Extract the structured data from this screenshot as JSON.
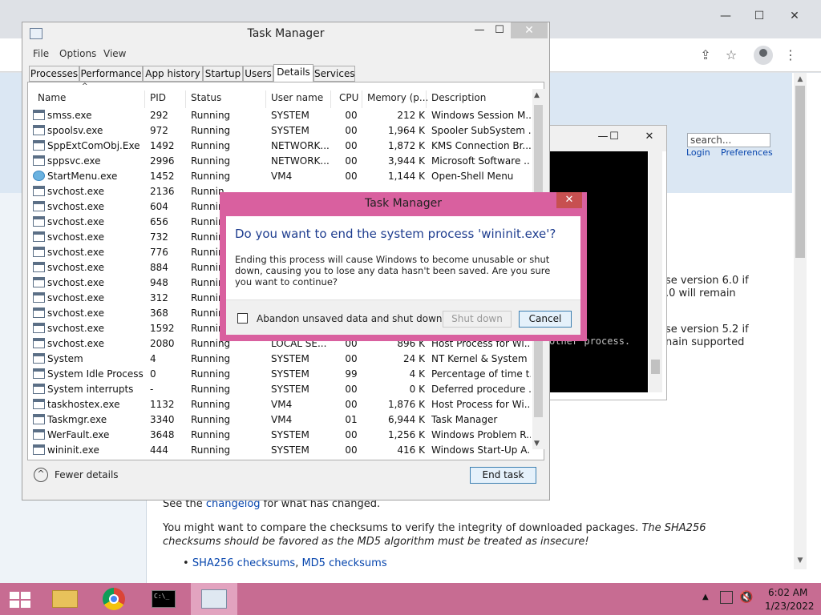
{
  "colors": {
    "dialog_frame": "#d9609f",
    "taskbar": "#c76c92",
    "question_text": "#1e3d8f",
    "link": "#0645ad"
  },
  "browser": {
    "window_controls": [
      "—",
      "☐",
      "✕"
    ],
    "toolbar_icons": [
      "share-icon",
      "star-icon",
      "profile-icon",
      "menu-kebab-icon"
    ],
    "search": {
      "placeholder": "search..."
    },
    "links": {
      "login": "Login",
      "preferences": "Preferences"
    },
    "text_fragments": {
      "frag1": "se version 6.0 if",
      "frag2": ".0 will remain",
      "frag3": "se version 5.2 if",
      "frag4": "nain supported"
    },
    "changelog_pre": "See the",
    "changelog_link": "changelog",
    "changelog_post": "for what has changed.",
    "checksum_text": "You might want to compare the checksums to verify the integrity of downloaded packages.",
    "checksum_italic": "The SHA256 checksums should be favored as the MD5 algorithm must be treated as insecure!",
    "sha_link": "SHA256 checksums",
    "md5_link": "MD5 checksums"
  },
  "console": {
    "buttons": [
      "—",
      "☐",
      "✕"
    ],
    "text": "other process."
  },
  "task_manager": {
    "title": "Task Manager",
    "window_controls": [
      "—",
      "☐",
      "✕"
    ],
    "menu": [
      "File",
      "Options",
      "View"
    ],
    "tabs": [
      "Processes",
      "Performance",
      "App history",
      "Startup",
      "Users",
      "Details",
      "Services"
    ],
    "active_tab": "Details",
    "columns": [
      "Name",
      "PID",
      "Status",
      "User name",
      "CPU",
      "Memory (p...",
      "Description"
    ],
    "rows": [
      [
        "smss.exe",
        "292",
        "Running",
        "SYSTEM",
        "00",
        "212 K",
        "Windows Session M..."
      ],
      [
        "spoolsv.exe",
        "972",
        "Running",
        "SYSTEM",
        "00",
        "1,964 K",
        "Spooler SubSystem ..."
      ],
      [
        "SppExtComObj.Exe",
        "1492",
        "Running",
        "NETWORK...",
        "00",
        "1,872 K",
        "KMS Connection Br..."
      ],
      [
        "sppsvc.exe",
        "2996",
        "Running",
        "NETWORK...",
        "00",
        "3,944 K",
        "Microsoft Software ..."
      ],
      [
        "StartMenu.exe",
        "1452",
        "Running",
        "VM4",
        "00",
        "1,144 K",
        "Open-Shell Menu"
      ],
      [
        "svchost.exe",
        "2136",
        "Runnin",
        "",
        "",
        "",
        ""
      ],
      [
        "svchost.exe",
        "604",
        "Runnin",
        "",
        "",
        "",
        ""
      ],
      [
        "svchost.exe",
        "656",
        "Runnin",
        "",
        "",
        "",
        ""
      ],
      [
        "svchost.exe",
        "732",
        "Runnin",
        "",
        "",
        "",
        ""
      ],
      [
        "svchost.exe",
        "776",
        "Runnin",
        "",
        "",
        "",
        ""
      ],
      [
        "svchost.exe",
        "884",
        "Runnin",
        "",
        "",
        "",
        ""
      ],
      [
        "svchost.exe",
        "948",
        "Runnin",
        "",
        "",
        "",
        ""
      ],
      [
        "svchost.exe",
        "312",
        "Runnin",
        "",
        "",
        "",
        ""
      ],
      [
        "svchost.exe",
        "368",
        "Runnin",
        "",
        "",
        "",
        ""
      ],
      [
        "svchost.exe",
        "1592",
        "Runnin",
        "",
        "",
        "",
        ""
      ],
      [
        "svchost.exe",
        "2080",
        "Running",
        "LOCAL SE...",
        "00",
        "896 K",
        "Host Process for Wi..."
      ],
      [
        "System",
        "4",
        "Running",
        "SYSTEM",
        "00",
        "24 K",
        "NT Kernel & System"
      ],
      [
        "System Idle Process",
        "0",
        "Running",
        "SYSTEM",
        "99",
        "4 K",
        "Percentage of time t..."
      ],
      [
        "System interrupts",
        "-",
        "Running",
        "SYSTEM",
        "00",
        "0 K",
        "Deferred procedure ..."
      ],
      [
        "taskhostex.exe",
        "1132",
        "Running",
        "VM4",
        "00",
        "1,876 K",
        "Host Process for Wi..."
      ],
      [
        "Taskmgr.exe",
        "3340",
        "Running",
        "VM4",
        "01",
        "6,944 K",
        "Task Manager"
      ],
      [
        "WerFault.exe",
        "3648",
        "Running",
        "SYSTEM",
        "00",
        "1,256 K",
        "Windows Problem R..."
      ],
      [
        "wininit.exe",
        "444",
        "Running",
        "SYSTEM",
        "00",
        "416 K",
        "Windows Start-Up A..."
      ]
    ],
    "fewer_details": "Fewer details",
    "end_task": "End task"
  },
  "dialog": {
    "title": "Task Manager",
    "question": "Do you want to end the system process 'wininit.exe'?",
    "message": "Ending this process will cause Windows to become unusable or shut down, causing you to lose any data hasn't been saved. Are you sure you want to continue?",
    "checkbox_label": "Abandon unsaved data and shut down.",
    "checkbox_checked": false,
    "shutdown_label": "Shut down",
    "cancel_label": "Cancel"
  },
  "taskbar": {
    "items": [
      "start-button",
      "file-explorer",
      "chrome",
      "command-prompt",
      "task-manager"
    ],
    "time": "6:02 AM",
    "date": "1/23/2022"
  }
}
